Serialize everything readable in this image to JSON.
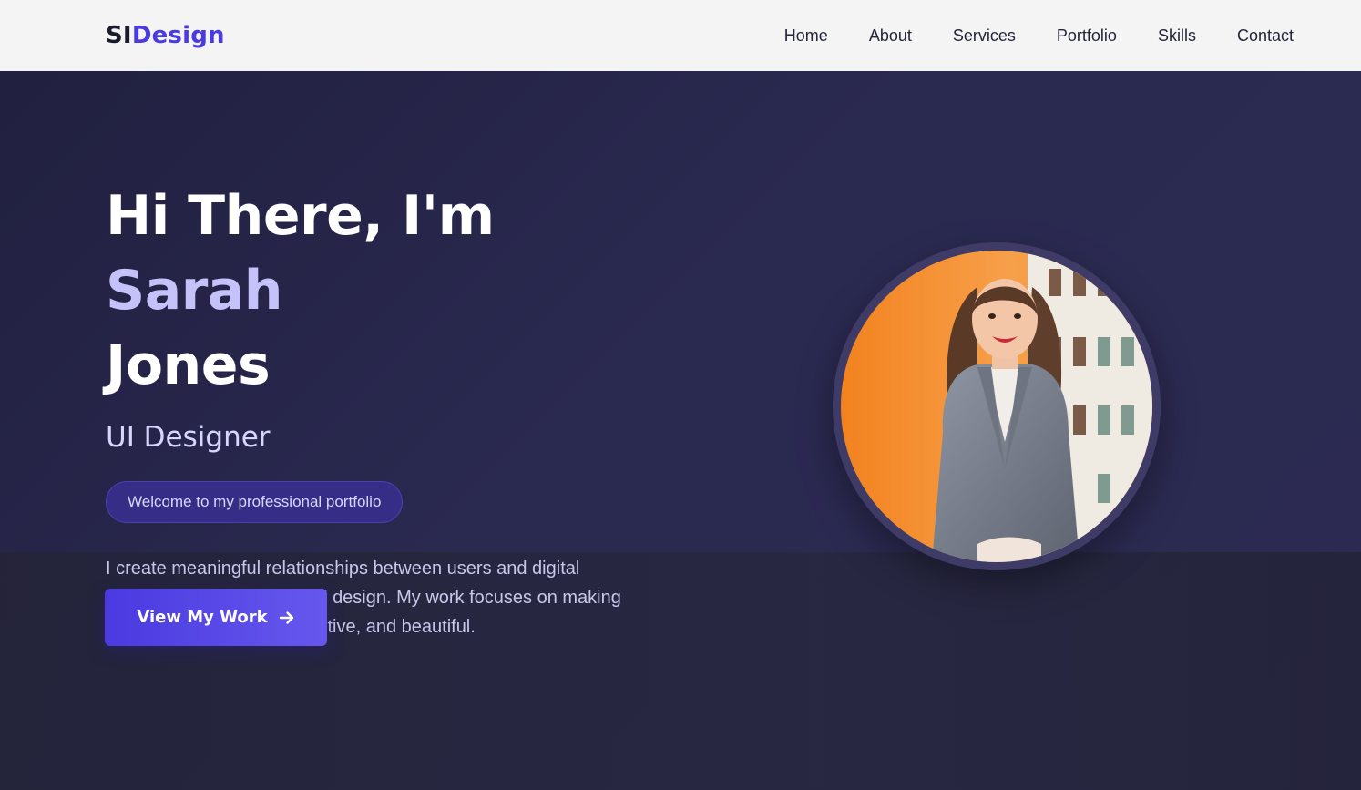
{
  "logo": {
    "part1": "SI",
    "part2": "Design"
  },
  "nav": {
    "items": [
      {
        "label": "Home"
      },
      {
        "label": "About"
      },
      {
        "label": "Services"
      },
      {
        "label": "Portfolio"
      },
      {
        "label": "Skills"
      },
      {
        "label": "Contact"
      }
    ]
  },
  "hero": {
    "title_line1": "Hi There, I'm ",
    "title_name": "Sarah",
    "title_line2": "Jones",
    "role": "UI Designer",
    "badge": "Welcome to my professional portfolio",
    "intro": "I create meaningful relationships between users and digital products through thoughtful design. My work focuses on making technology accessible, intuitive, and beautiful.",
    "cta_label": "View My Work",
    "cta_icon": "arrow-right-icon"
  },
  "colors": {
    "brand": "#4b3ae0",
    "accent": "#c4c2f8",
    "hero_bg": "#23233d",
    "nav_bg": "#f4f4f5"
  }
}
